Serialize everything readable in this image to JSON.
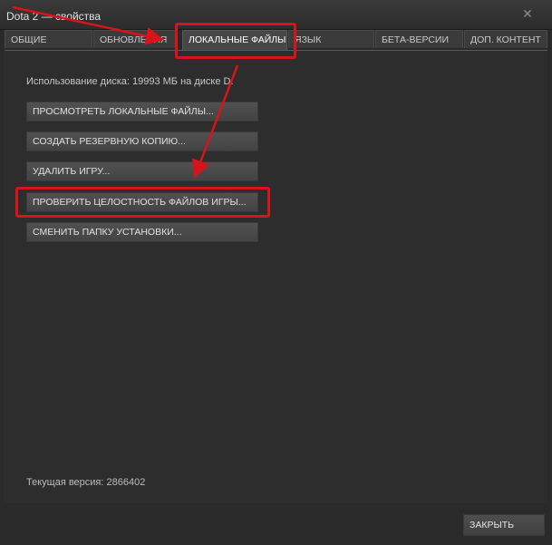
{
  "window": {
    "title": "Dota 2 — свойства",
    "close_glyph": "✕"
  },
  "tabs": [
    {
      "label": "ОБЩИЕ"
    },
    {
      "label": "ОБНОВЛЕНИЯ"
    },
    {
      "label": "ЛОКАЛЬНЫЕ ФАЙЛЫ",
      "active": true
    },
    {
      "label": "ЯЗЫК"
    },
    {
      "label": "БЕТА-ВЕРСИИ"
    },
    {
      "label": "ДОП. КОНТЕНТ"
    }
  ],
  "panel": {
    "disk_usage": "Использование диска: 19993 МБ на диске D:",
    "buttons": [
      {
        "label": "ПРОСМОТРЕТЬ ЛОКАЛЬНЫЕ ФАЙЛЫ..."
      },
      {
        "label": "СОЗДАТЬ РЕЗЕРВНУЮ КОПИЮ..."
      },
      {
        "label": "УДАЛИТЬ ИГРУ..."
      },
      {
        "label": "ПРОВЕРИТЬ ЦЕЛОСТНОСТЬ ФАЙЛОВ ИГРЫ..."
      },
      {
        "label": "СМЕНИТЬ ПАПКУ УСТАНОВКИ..."
      }
    ],
    "current_version": "Текущая версия: 2866402"
  },
  "footer": {
    "close_label": "ЗАКРЫТЬ"
  },
  "colors": {
    "annotation": "#d8141a",
    "background": "#2d2d2d",
    "button": "#4a4a4a"
  }
}
